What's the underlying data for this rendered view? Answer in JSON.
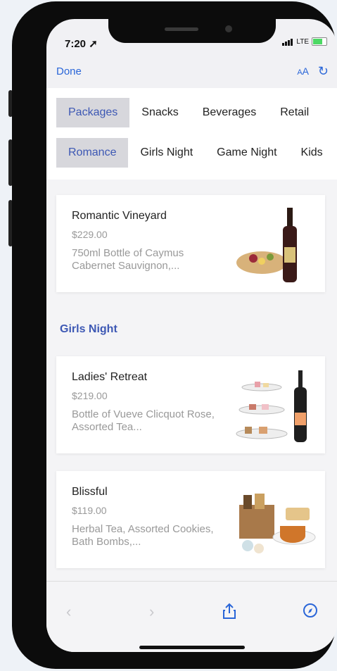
{
  "status": {
    "time": "7:20",
    "carrier": "LTE"
  },
  "browser": {
    "done_label": "Done",
    "text_size_label": "AA"
  },
  "tabs_primary": [
    "Packages",
    "Snacks",
    "Beverages",
    "Retail"
  ],
  "tabs_secondary": [
    "Romance",
    "Girls Night",
    "Game Night",
    "Kids"
  ],
  "cards_top": [
    {
      "name": "Romantic Vineyard",
      "price": "$229.00",
      "desc": "750ml Bottle of Caymus Cabernet Sauvignon,..."
    }
  ],
  "section_title": "Girls Night",
  "cards": [
    {
      "name": "Ladies' Retreat",
      "price": "$219.00",
      "desc": "Bottle of Vueve Clicquot Rose, Assorted Tea..."
    },
    {
      "name": "Blissful",
      "price": "$119.00",
      "desc": "Herbal Tea, Assorted Cookies, Bath Bombs,..."
    }
  ],
  "colors": {
    "accent": "#2a66d8",
    "tab_text_active": "#3d58b4"
  }
}
